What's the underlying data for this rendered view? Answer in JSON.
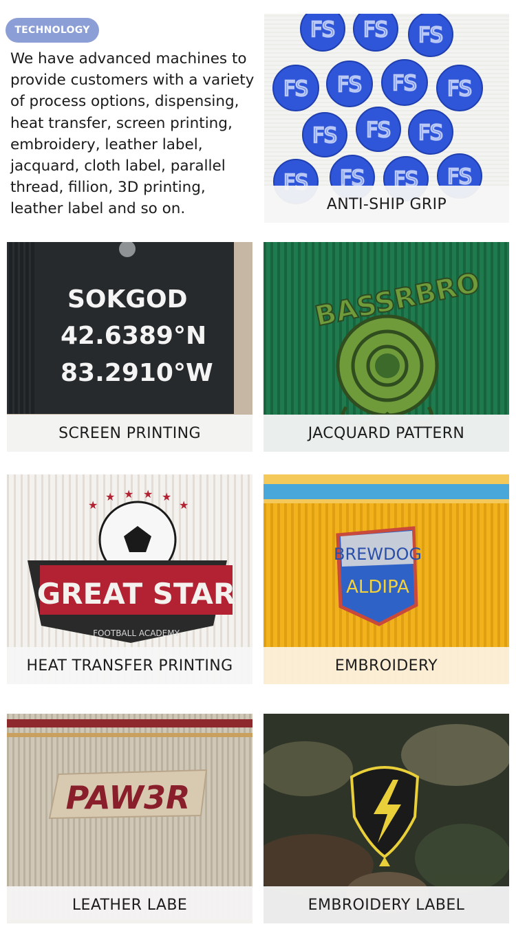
{
  "header": {
    "badge": "TECHNOLOGY",
    "intro": "We have advanced machines to provide customers with a variety of process options, dispensing, heat transfer, screen printing, embroidery, leather label, jacquard, cloth label, parallel thread, fillion, 3D printing, leather label and so on."
  },
  "tiles": {
    "grip": {
      "caption": "ANTI-SHIP GRIP",
      "dot_text": "FS"
    },
    "screen": {
      "caption": "SCREEN PRINTING",
      "lines": [
        "SOKGOD",
        "42.6389°N",
        "83.2910°W"
      ]
    },
    "jacquard": {
      "caption": "JACQUARD PATTERN",
      "arc_text": "BASSRBRO"
    },
    "heat": {
      "caption": "HEAT TRANSFER PRINTING",
      "logo_title": "GREAT STAR",
      "logo_sub": "FOOTBALL ACADEMY"
    },
    "embroidery": {
      "caption": "EMBROIDERY",
      "patch_line1": "BREWDOG",
      "patch_line2": "ALDIPA"
    },
    "leather": {
      "caption": "LEATHER LABE",
      "label_text": "PAW3R"
    },
    "embroidery_label": {
      "caption": "EMBROIDERY LABEL"
    }
  },
  "colors": {
    "badge": "#8c9ed6",
    "grip_blue": "#2f56d8",
    "jacquard_green": "#1f7a4e",
    "embroidery_yellow": "#f2b21c",
    "heat_red": "#b22233"
  }
}
